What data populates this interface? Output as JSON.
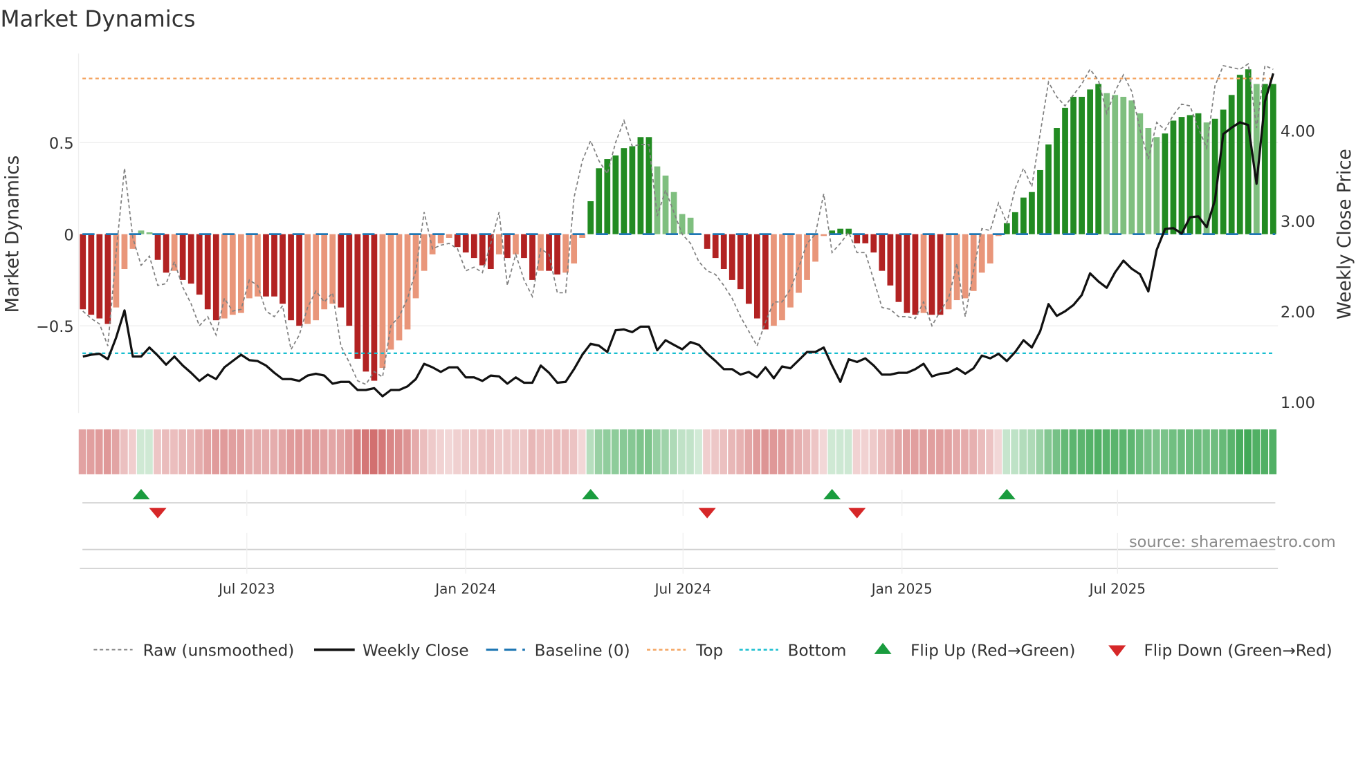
{
  "title": "Market Dynamics",
  "chart_data": {
    "type": "bar",
    "title": "Market Dynamics",
    "ylabel": "Market Dynamics",
    "y2label": "Weekly Close Price",
    "ylim": [
      -0.976,
      0.986
    ],
    "y2lim": [
      0.876,
      4.85
    ],
    "frequency": "weekly",
    "yticks": [
      {
        "value": 0.5,
        "label": "0.5"
      },
      {
        "value": 0,
        "label": "0"
      },
      {
        "value": -0.5,
        "label": "−0.5"
      }
    ],
    "y2ticks": [
      {
        "value": 4,
        "label": "4.00"
      },
      {
        "value": 3,
        "label": "3.00"
      },
      {
        "value": 2,
        "label": "2.00"
      },
      {
        "value": 1,
        "label": "1.00"
      }
    ],
    "xticks": [
      {
        "week": 19.7,
        "label": "Jul 2023"
      },
      {
        "week": 46.0,
        "label": "Jan 2024"
      },
      {
        "week": 72.1,
        "label": "Jul 2024"
      },
      {
        "week": 98.4,
        "label": "Jan 2025"
      },
      {
        "week": 124.3,
        "label": "Jul 2025"
      }
    ],
    "top_level": 0.85,
    "bottom_level": -0.65,
    "baseline": 0,
    "grid": true,
    "legend_position": "bottom",
    "smoothed": [
      -0.41,
      -0.44,
      -0.46,
      -0.49,
      -0.4,
      -0.19,
      -0.08,
      0.02,
      0.01,
      -0.14,
      -0.21,
      -0.2,
      -0.25,
      -0.27,
      -0.33,
      -0.41,
      -0.47,
      -0.46,
      -0.44,
      -0.43,
      -0.35,
      -0.34,
      -0.34,
      -0.34,
      -0.38,
      -0.47,
      -0.5,
      -0.49,
      -0.47,
      -0.41,
      -0.38,
      -0.4,
      -0.5,
      -0.68,
      -0.75,
      -0.8,
      -0.73,
      -0.63,
      -0.58,
      -0.52,
      -0.35,
      -0.2,
      -0.11,
      -0.05,
      -0.02,
      -0.07,
      -0.1,
      -0.13,
      -0.17,
      -0.19,
      -0.11,
      -0.13,
      -0.11,
      -0.13,
      -0.25,
      -0.2,
      -0.2,
      -0.22,
      -0.21,
      -0.16,
      -0.02,
      0.18,
      0.36,
      0.41,
      0.43,
      0.47,
      0.48,
      0.53,
      0.53,
      0.37,
      0.32,
      0.23,
      0.11,
      0.09,
      0.0,
      -0.08,
      -0.13,
      -0.19,
      -0.25,
      -0.3,
      -0.38,
      -0.46,
      -0.52,
      -0.5,
      -0.47,
      -0.4,
      -0.32,
      -0.25,
      -0.15,
      -0.01,
      0.02,
      0.03,
      0.03,
      -0.05,
      -0.05,
      -0.1,
      -0.2,
      -0.28,
      -0.37,
      -0.43,
      -0.44,
      -0.43,
      -0.44,
      -0.44,
      -0.41,
      -0.36,
      -0.35,
      -0.31,
      -0.21,
      -0.16,
      -0.01,
      0.06,
      0.12,
      0.2,
      0.23,
      0.35,
      0.49,
      0.58,
      0.69,
      0.75,
      0.75,
      0.79,
      0.82,
      0.77,
      0.76,
      0.75,
      0.73,
      0.66,
      0.58,
      0.53,
      0.55,
      0.62,
      0.64,
      0.65,
      0.66,
      0.61,
      0.63,
      0.68,
      0.76,
      0.87,
      0.9,
      0.82,
      0.82,
      0.82
    ],
    "raw": [
      -0.42,
      -0.46,
      -0.49,
      -0.61,
      -0.1,
      0.36,
      -0.02,
      -0.17,
      -0.12,
      -0.28,
      -0.27,
      -0.15,
      -0.29,
      -0.38,
      -0.5,
      -0.45,
      -0.55,
      -0.35,
      -0.42,
      -0.41,
      -0.25,
      -0.28,
      -0.42,
      -0.45,
      -0.39,
      -0.63,
      -0.55,
      -0.4,
      -0.31,
      -0.37,
      -0.32,
      -0.61,
      -0.7,
      -0.8,
      -0.82,
      -0.75,
      -0.78,
      -0.5,
      -0.45,
      -0.35,
      -0.2,
      0.12,
      -0.08,
      -0.06,
      -0.05,
      -0.08,
      -0.2,
      -0.18,
      -0.21,
      -0.05,
      0.12,
      -0.28,
      -0.11,
      -0.25,
      -0.34,
      -0.08,
      -0.11,
      -0.32,
      -0.32,
      0.2,
      0.4,
      0.51,
      0.4,
      0.33,
      0.5,
      0.62,
      0.48,
      0.49,
      0.49,
      0.1,
      0.24,
      0.12,
      0.0,
      -0.05,
      -0.15,
      -0.2,
      -0.22,
      -0.28,
      -0.35,
      -0.45,
      -0.53,
      -0.61,
      -0.48,
      -0.37,
      -0.37,
      -0.3,
      -0.18,
      -0.05,
      0.0,
      0.22,
      -0.1,
      -0.05,
      0.01,
      -0.1,
      -0.1,
      -0.25,
      -0.4,
      -0.41,
      -0.45,
      -0.45,
      -0.46,
      -0.37,
      -0.5,
      -0.42,
      -0.35,
      -0.16,
      -0.45,
      -0.2,
      0.03,
      0.02,
      0.17,
      0.06,
      0.25,
      0.36,
      0.26,
      0.55,
      0.83,
      0.75,
      0.7,
      0.76,
      0.82,
      0.9,
      0.84,
      0.66,
      0.78,
      0.87,
      0.78,
      0.57,
      0.41,
      0.61,
      0.57,
      0.65,
      0.71,
      0.7,
      0.58,
      0.47,
      0.81,
      0.92,
      0.91,
      0.9,
      0.93,
      0.58,
      0.92,
      0.9
    ],
    "weekly_close": [
      1.5,
      1.52,
      1.53,
      1.47,
      1.71,
      2.01,
      1.5,
      1.5,
      1.6,
      1.51,
      1.41,
      1.5,
      1.4,
      1.32,
      1.23,
      1.3,
      1.25,
      1.38,
      1.45,
      1.52,
      1.46,
      1.45,
      1.4,
      1.32,
      1.25,
      1.25,
      1.23,
      1.29,
      1.31,
      1.29,
      1.2,
      1.22,
      1.22,
      1.13,
      1.13,
      1.15,
      1.06,
      1.13,
      1.13,
      1.17,
      1.25,
      1.42,
      1.38,
      1.33,
      1.38,
      1.38,
      1.27,
      1.27,
      1.23,
      1.29,
      1.28,
      1.2,
      1.27,
      1.21,
      1.21,
      1.4,
      1.32,
      1.21,
      1.22,
      1.36,
      1.52,
      1.64,
      1.62,
      1.55,
      1.79,
      1.8,
      1.77,
      1.83,
      1.83,
      1.57,
      1.68,
      1.63,
      1.58,
      1.66,
      1.63,
      1.53,
      1.45,
      1.36,
      1.36,
      1.3,
      1.33,
      1.27,
      1.38,
      1.26,
      1.39,
      1.37,
      1.46,
      1.55,
      1.55,
      1.6,
      1.4,
      1.22,
      1.47,
      1.44,
      1.48,
      1.4,
      1.3,
      1.3,
      1.32,
      1.32,
      1.36,
      1.42,
      1.28,
      1.31,
      1.32,
      1.37,
      1.31,
      1.37,
      1.51,
      1.48,
      1.53,
      1.45,
      1.55,
      1.68,
      1.6,
      1.78,
      2.08,
      1.95,
      2.0,
      2.07,
      2.18,
      2.42,
      2.33,
      2.26,
      2.43,
      2.56,
      2.47,
      2.41,
      2.22,
      2.68,
      2.91,
      2.92,
      2.86,
      3.04,
      3.05,
      2.93,
      3.23,
      3.96,
      4.03,
      4.09,
      4.06,
      3.41,
      4.32,
      4.63
    ],
    "flip_up_weeks": [
      7,
      61,
      90,
      111
    ],
    "flip_down_weeks": [
      9,
      75,
      93
    ],
    "legend": [
      {
        "key": "raw",
        "label": "Raw (unsmoothed)"
      },
      {
        "key": "close",
        "label": "Weekly Close"
      },
      {
        "key": "baseline",
        "label": "Baseline (0)"
      },
      {
        "key": "top",
        "label": "Top"
      },
      {
        "key": "bottom",
        "label": "Bottom"
      },
      {
        "key": "flip_up",
        "label": "Flip Up (Red→Green)"
      },
      {
        "key": "flip_down",
        "label": "Flip Down (Green→Red)"
      }
    ],
    "colors": {
      "pos_strong": "#228b22",
      "pos_weak": "#7fbf7f",
      "neg_strong": "#b22222",
      "neg_weak": "#e9967a",
      "raw": "#808080",
      "close": "#111111",
      "baseline": "#1f77b4",
      "top": "#f4a460",
      "bottom": "#17becf",
      "flip_up": "#1a9c3e",
      "flip_down": "#d62728"
    }
  },
  "source": "source: sharemaestro.com"
}
